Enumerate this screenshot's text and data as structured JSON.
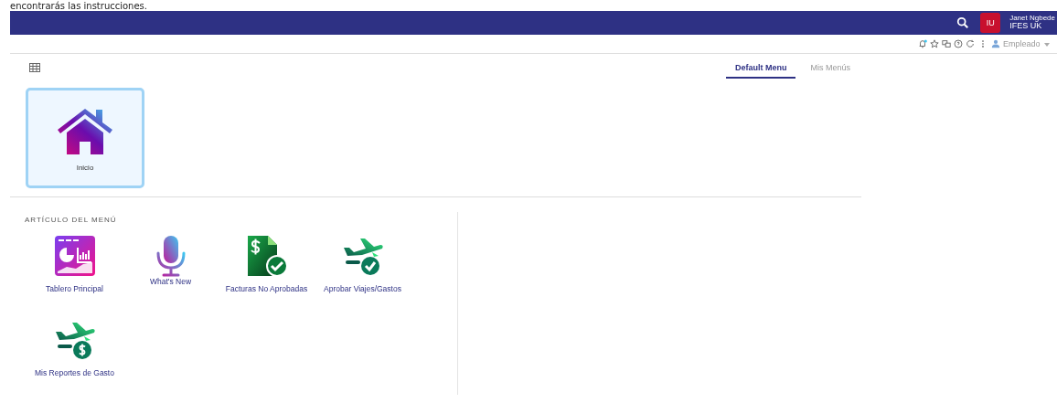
{
  "top_text": "encontrarás las instrucciones.",
  "header": {
    "avatar": "IU",
    "user_name": "Janet Ngbede",
    "organization": "IFES UK"
  },
  "toolbar": {
    "role": "Empleado"
  },
  "menu_tabs": [
    {
      "label": "Default Menu",
      "selected": true
    },
    {
      "label": "Mis Menús",
      "selected": false
    }
  ],
  "favorites": [
    {
      "label": "Inicio",
      "kind": "home",
      "selected": true
    }
  ],
  "section": {
    "title": "ARTÍCULO DEL MENÚ",
    "items": [
      {
        "label": "Tablero Principal",
        "kind": "dashboard"
      },
      {
        "label": "What's New",
        "kind": "microphone"
      },
      {
        "label": "Facturas No Aprobadas",
        "kind": "invoice"
      },
      {
        "label": "Aprobar Viajes/Gastos",
        "kind": "travel-approve"
      },
      {
        "label": "Mis Reportes de Gasto",
        "kind": "travel-expense"
      }
    ]
  }
}
